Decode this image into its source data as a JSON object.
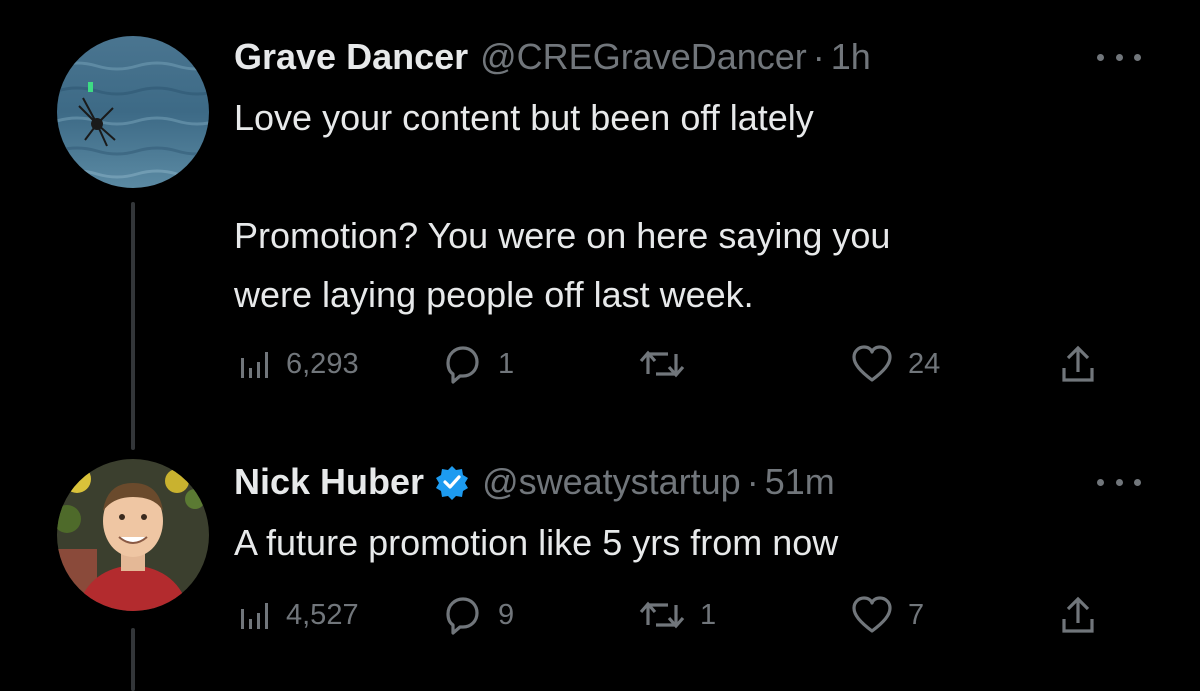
{
  "thread": [
    {
      "name": "Grave Dancer",
      "handle": "@CREGraveDancer",
      "separator": "·",
      "time": "1h",
      "verified": false,
      "avatar_icon": "ocean-spider-avatar",
      "text": "Love your content but been off lately\n\nPromotion? You were on here saying you\nwere laying people off last week.",
      "stats": {
        "views": "6,293",
        "replies": "1",
        "retweets": "",
        "likes": "24"
      }
    },
    {
      "name": "Nick Huber",
      "handle": "@sweatystartup",
      "separator": "·",
      "time": "51m",
      "verified": true,
      "avatar_icon": "person-avatar",
      "text": "A future promotion like 5 yrs from now",
      "stats": {
        "views": "4,527",
        "replies": "9",
        "retweets": "1",
        "likes": "7"
      }
    }
  ],
  "colors": {
    "background": "#000000",
    "primary_text": "#e7e9ea",
    "secondary_text": "#71767b",
    "verified_badge": "#1d9bf0",
    "thread_line": "#333639"
  }
}
